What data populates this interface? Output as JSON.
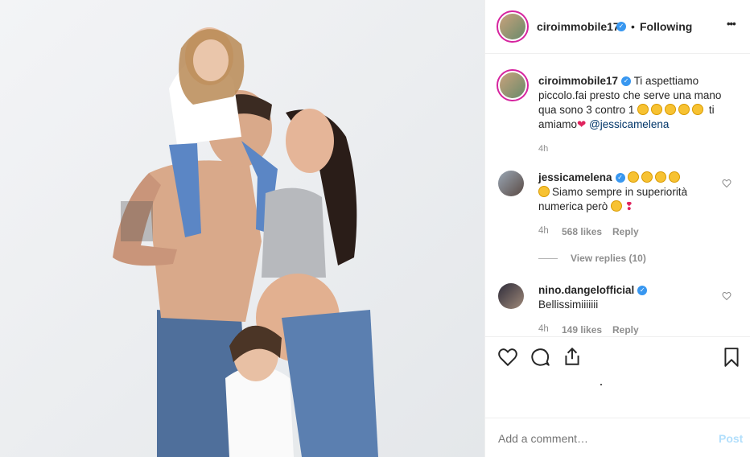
{
  "post": {
    "username": "ciroimmobile17",
    "follow_status": "Following",
    "more_label": "•••",
    "separator": "•"
  },
  "caption": {
    "username": "ciroimmobile17",
    "text_part1": "Ti aspettiamo piccolo.fai presto che serve una mano qua sono 3 contro 1",
    "text_part2": "ti amiamo",
    "mention": "@jessicamelena",
    "time": "4h"
  },
  "comments": [
    {
      "username": "jessicamelena",
      "text": "Siamo sempre in superiorità numerica però",
      "time": "4h",
      "likes": "568 likes",
      "reply_label": "Reply",
      "view_replies": "View replies (10)"
    },
    {
      "username": "nino.dangelofficial",
      "text": "Bellissimiiiiiii",
      "time": "4h",
      "likes": "149 likes",
      "reply_label": "Reply"
    }
  ],
  "composer": {
    "placeholder": "Add a comment…",
    "post_label": "Post"
  },
  "icons": [
    "heart-icon",
    "comment-icon",
    "share-icon",
    "bookmark-icon",
    "verified-icon"
  ],
  "colors": {
    "verified": "#3897f0",
    "link": "#003569",
    "post_button": "#b2dffc",
    "muted": "#8e8e8e"
  }
}
